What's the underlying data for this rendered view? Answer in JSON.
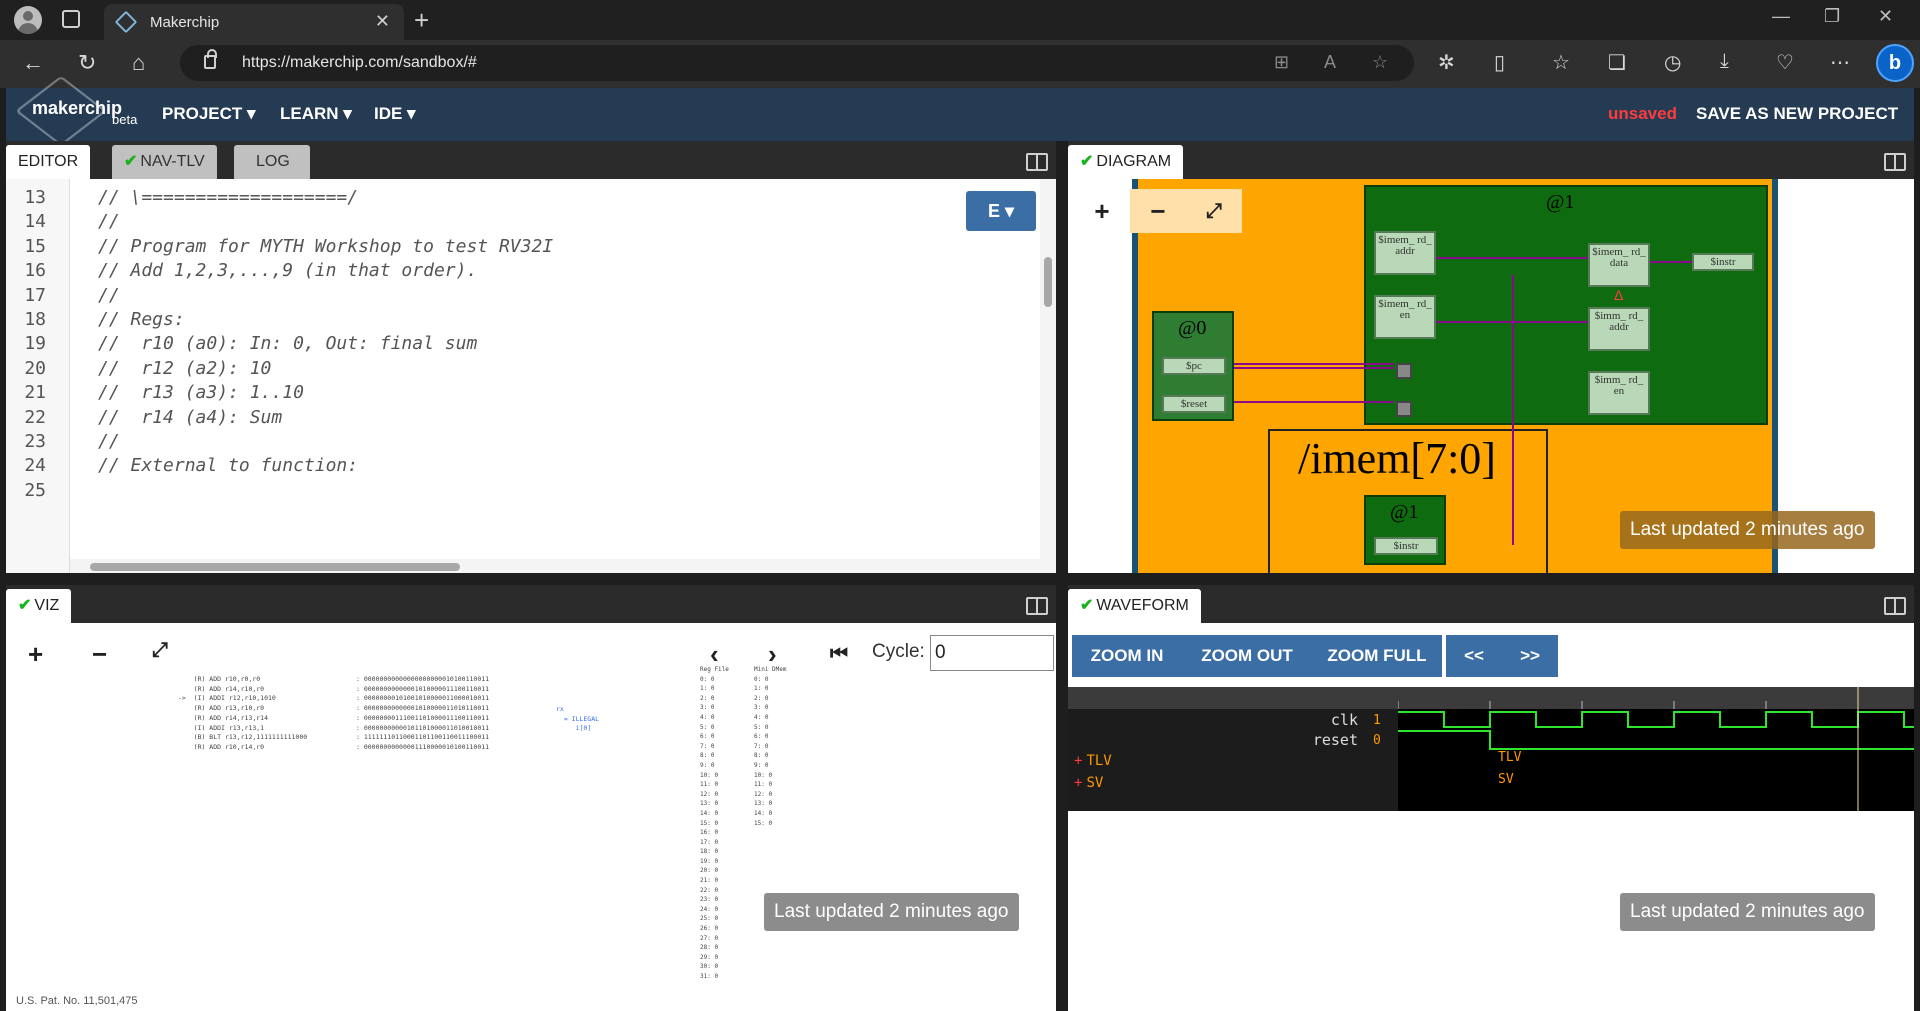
{
  "browser": {
    "tab_title": "Makerchip",
    "url": "https://makerchip.com/sandbox/#",
    "bing_label": "b"
  },
  "header": {
    "logo": "makerchip",
    "beta": "beta",
    "menus": [
      "PROJECT ▾",
      "LEARN ▾",
      "IDE ▾"
    ],
    "unsaved": "unsaved",
    "save_label": "SAVE AS NEW PROJECT"
  },
  "editor": {
    "tabs": [
      "EDITOR",
      "NAV-TLV",
      "LOG"
    ],
    "e_button": "E ▾",
    "line_numbers": [
      "13",
      "14",
      "15",
      "16",
      "17",
      "18",
      "19",
      "20",
      "21",
      "22",
      "23",
      "24",
      "25"
    ],
    "lines": [
      "// \\===================/",
      "//",
      "// Program for MYTH Workshop to test RV32I",
      "// Add 1,2,3,...,9 (in that order).",
      "//",
      "// Regs:",
      "//  r10 (a0): In: 0, Out: final sum",
      "//  r12 (a2): 10",
      "//  r13 (a3): 1..10",
      "//  r14 (a4): Sum",
      "//",
      "// External to function:",
      ""
    ]
  },
  "diagram": {
    "tab": "DIAGRAM",
    "stage0": "@0",
    "stage1": "@1",
    "stage1b": "@1",
    "imem_label": "/imem[7:0]",
    "signals": {
      "pc": "$pc",
      "reset": "$reset",
      "imem_rd_addr": "$imem_ rd_ addr",
      "imem_rd_en": "$imem_ rd_ en",
      "imem_rd_data": "$imem_ rd_ data",
      "imm_rd_addr": "$imm_ rd_ addr",
      "imm_rd_en": "$imm_ rd_ en",
      "instr": "$instr",
      "instr_bottom": "$instr"
    },
    "delta": "Δ",
    "updated": "Last updated 2 minutes ago"
  },
  "viz": {
    "tab": "VIZ",
    "cycle_label": "Cycle:",
    "cycle_value": "0",
    "updated": "Last updated 2 minutes ago",
    "patent": "U.S. Pat. No. 11,501,475",
    "instr_list": "    (R) ADD r10,r0,r0\n    (R) ADD r14,r10,r0\n->  (I) ADDI r12,r10,1010\n    (R) ADD r13,r10,r0\n    (R) ADD r14,r13,r14\n    (I) ADDI r13,r13,1\n    (B) BLT r13,r12,1111111111000\n    (R) ADD r10,r14,r0",
    "instr_bits": ": 00000000000000000000010100110011\n: 00000000000001010000011100110011\n: 00000000101001010000011000010011\n: 00000000000001010000011010110011\n: 00000000111001101000011100110011\n: 00000000000101101000011010010011\n: 11111110110001101100110011100011\n: 00000000000001110000010100110011",
    "illegal": "rx\n  = ILLEGAL\n     i[0]",
    "regfile": "Reg File\n0: 0\n1: 0\n2: 0\n3: 0\n4: 0\n5: 0\n6: 0\n7: 0\n8: 0\n9: 0\n10: 0\n11: 0\n12: 0\n13: 0\n14: 0\n15: 0\n16: 0\n17: 0\n18: 0\n19: 0\n20: 0\n21: 0\n22: 0\n23: 0\n24: 0\n25: 0\n26: 0\n27: 0\n28: 0\n29: 0\n30: 0\n31: 0",
    "dmem": "Mini DMem\n0: 0\n1: 0\n2: 0\n3: 0\n4: 0\n5: 0\n6: 0\n7: 0\n8: 0\n9: 0\n10: 0\n11: 0\n12: 0\n13: 0\n14: 0\n15: 0"
  },
  "waveform": {
    "tab": "WAVEFORM",
    "buttons": [
      "ZOOM IN",
      "ZOOM OUT",
      "ZOOM FULL",
      "<<",
      ">>"
    ],
    "signals": [
      {
        "name": "clk",
        "value": "1"
      },
      {
        "name": "reset",
        "value": "0"
      }
    ],
    "groups": [
      "TLV",
      "SV"
    ],
    "updated": "Last updated 2 minutes ago"
  }
}
